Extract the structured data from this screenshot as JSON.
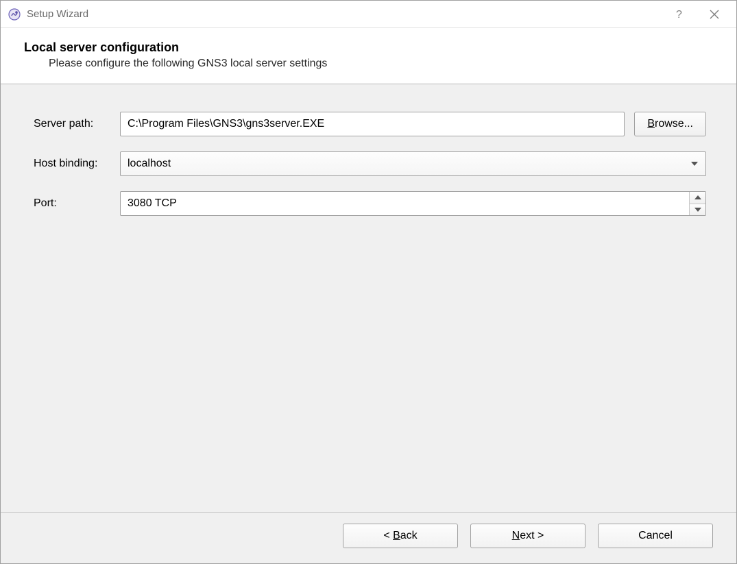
{
  "window": {
    "title": "Setup Wizard"
  },
  "header": {
    "title": "Local server configuration",
    "subtitle": "Please configure the following GNS3 local server settings"
  },
  "form": {
    "server_path": {
      "label": "Server path:",
      "value": "C:\\Program Files\\GNS3\\gns3server.EXE",
      "browse_label": "Browse..."
    },
    "host_binding": {
      "label": "Host binding:",
      "value": "localhost"
    },
    "port": {
      "label": "Port:",
      "value": "3080 TCP"
    }
  },
  "footer": {
    "back_label": "< Back",
    "next_label": "Next >",
    "cancel_label": "Cancel"
  }
}
